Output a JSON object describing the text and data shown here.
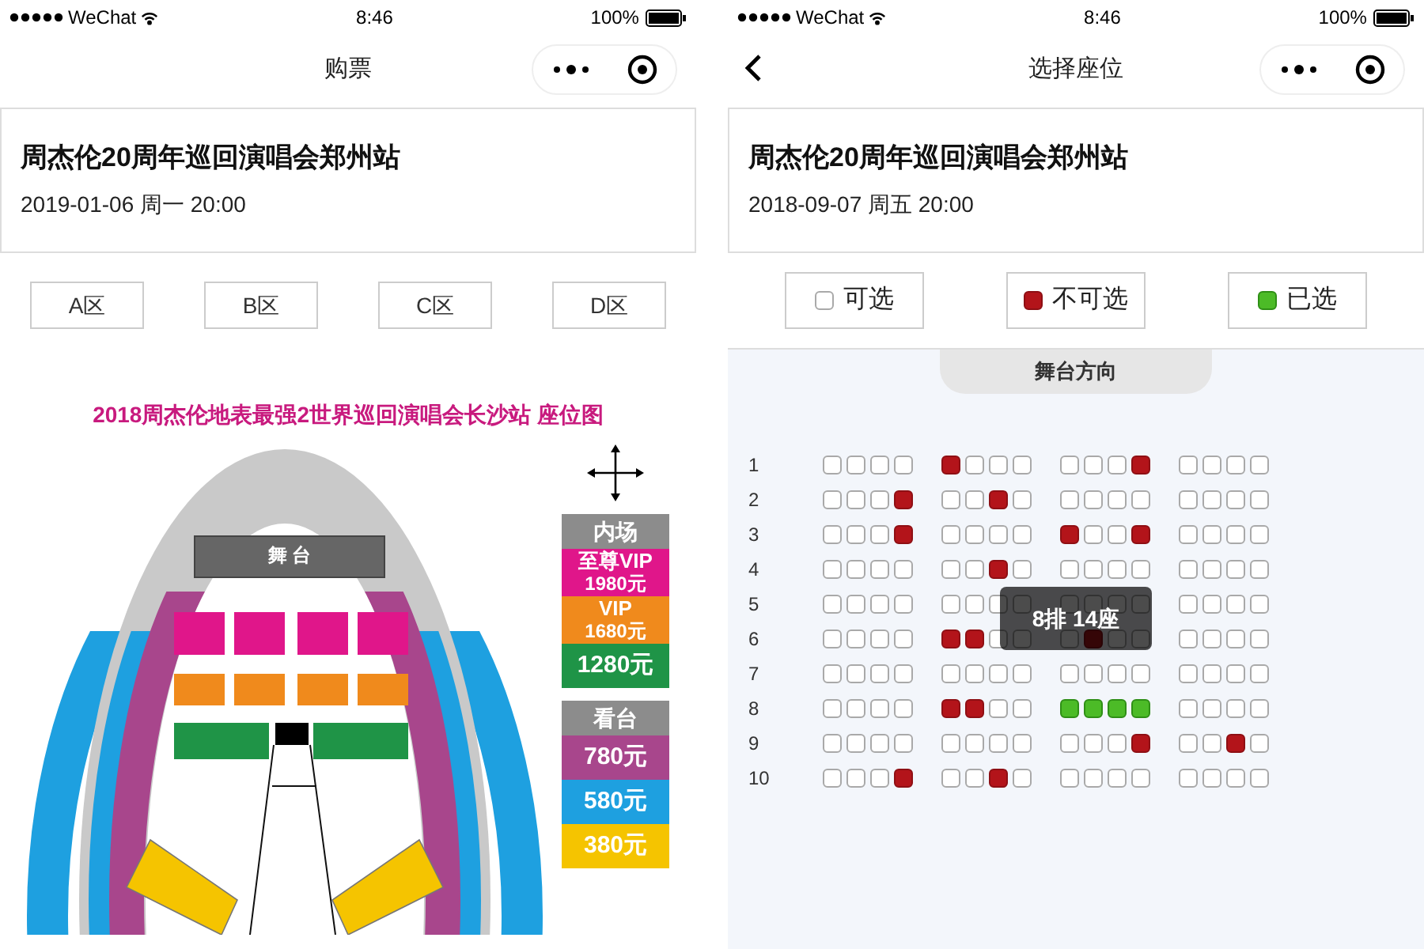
{
  "screens": [
    {
      "kind": "zone_picker",
      "status_bar": {
        "carrier": "WeChat",
        "time": "8:46",
        "battery": "100%"
      },
      "nav": {
        "title": "购票",
        "back": false
      },
      "event": {
        "title": "周杰伦20周年巡回演唱会郑州站",
        "datetime": "2019-01-06 周一 20:00"
      },
      "zones": [
        "A区",
        "B区",
        "C区",
        "D区"
      ],
      "seat_map": {
        "title": "2018周杰伦地表最强2世界巡回演唱会长沙站 座位图",
        "stage_label": "舞 台",
        "legend": [
          {
            "heading": "内场",
            "tiers": [
              {
                "name": "至尊VIP",
                "price": "1980元",
                "color": "#e0168a"
              },
              {
                "name": "VIP",
                "price": "1680元",
                "color": "#f08a1c"
              },
              {
                "price": "1280元",
                "color": "#1f9447"
              }
            ]
          },
          {
            "heading": "看台",
            "tiers": [
              {
                "price": "780元",
                "color": "#a8468c"
              },
              {
                "price": "580元",
                "color": "#1ea0e0"
              },
              {
                "price": "380元",
                "color": "#f5c400"
              }
            ]
          }
        ]
      }
    },
    {
      "kind": "seat_picker",
      "status_bar": {
        "carrier": "WeChat",
        "time": "8:46",
        "battery": "100%"
      },
      "nav": {
        "title": "选择座位",
        "back": true
      },
      "event": {
        "title": "周杰伦20周年巡回演唱会郑州站",
        "datetime": "2018-09-07 周五 20:00"
      },
      "legend": [
        {
          "label": "可选",
          "kind": "free"
        },
        {
          "label": "不可选",
          "kind": "sold"
        },
        {
          "label": "已选",
          "kind": "selected"
        }
      ],
      "stage_direction": "舞台方向",
      "rows": [
        {
          "label": "1",
          "seats": [
            {
              "kind": "free"
            },
            {
              "kind": "free"
            },
            {
              "kind": "free"
            },
            {
              "kind": "free"
            },
            {
              "kind": "sold"
            },
            {
              "kind": "free"
            },
            {
              "kind": "free"
            },
            {
              "kind": "free"
            },
            {
              "kind": "free"
            },
            {
              "kind": "free"
            },
            {
              "kind": "free"
            },
            {
              "kind": "sold"
            },
            {
              "kind": "free"
            },
            {
              "kind": "free"
            },
            {
              "kind": "free"
            },
            {
              "kind": "free"
            }
          ]
        },
        {
          "label": "2",
          "seats": [
            {
              "kind": "free"
            },
            {
              "kind": "free"
            },
            {
              "kind": "free"
            },
            {
              "kind": "sold"
            },
            {
              "kind": "free"
            },
            {
              "kind": "free"
            },
            {
              "kind": "sold"
            },
            {
              "kind": "free"
            },
            {
              "kind": "free"
            },
            {
              "kind": "free"
            },
            {
              "kind": "free"
            },
            {
              "kind": "free"
            },
            {
              "kind": "free"
            },
            {
              "kind": "free"
            },
            {
              "kind": "free"
            },
            {
              "kind": "free"
            }
          ]
        },
        {
          "label": "3",
          "seats": [
            {
              "kind": "free"
            },
            {
              "kind": "free"
            },
            {
              "kind": "free"
            },
            {
              "kind": "sold"
            },
            {
              "kind": "free"
            },
            {
              "kind": "free"
            },
            {
              "kind": "free"
            },
            {
              "kind": "free"
            },
            {
              "kind": "sold"
            },
            {
              "kind": "free"
            },
            {
              "kind": "free"
            },
            {
              "kind": "sold"
            },
            {
              "kind": "free"
            },
            {
              "kind": "free"
            },
            {
              "kind": "free"
            },
            {
              "kind": "free"
            }
          ]
        },
        {
          "label": "4",
          "seats": [
            {
              "kind": "free"
            },
            {
              "kind": "free"
            },
            {
              "kind": "free"
            },
            {
              "kind": "free"
            },
            {
              "kind": "free"
            },
            {
              "kind": "free"
            },
            {
              "kind": "sold"
            },
            {
              "kind": "free"
            },
            {
              "kind": "free"
            },
            {
              "kind": "free"
            },
            {
              "kind": "free"
            },
            {
              "kind": "free"
            },
            {
              "kind": "free"
            },
            {
              "kind": "free"
            },
            {
              "kind": "free"
            },
            {
              "kind": "free"
            }
          ]
        },
        {
          "label": "5",
          "seats": [
            {
              "kind": "free"
            },
            {
              "kind": "free"
            },
            {
              "kind": "free"
            },
            {
              "kind": "free"
            },
            {
              "kind": "free"
            },
            {
              "kind": "free"
            },
            {
              "kind": "free"
            },
            {
              "kind": "free"
            },
            {
              "kind": "free"
            },
            {
              "kind": "free"
            },
            {
              "kind": "free"
            },
            {
              "kind": "free"
            },
            {
              "kind": "free"
            },
            {
              "kind": "free"
            },
            {
              "kind": "free"
            },
            {
              "kind": "free"
            }
          ]
        },
        {
          "label": "6",
          "seats": [
            {
              "kind": "free"
            },
            {
              "kind": "free"
            },
            {
              "kind": "free"
            },
            {
              "kind": "free"
            },
            {
              "kind": "sold"
            },
            {
              "kind": "sold"
            },
            {
              "kind": "free"
            },
            {
              "kind": "free"
            },
            {
              "kind": "free"
            },
            {
              "kind": "sold"
            },
            {
              "kind": "free"
            },
            {
              "kind": "free"
            },
            {
              "kind": "free"
            },
            {
              "kind": "free"
            },
            {
              "kind": "free"
            },
            {
              "kind": "free"
            }
          ]
        },
        {
          "label": "7",
          "seats": [
            {
              "kind": "free"
            },
            {
              "kind": "free"
            },
            {
              "kind": "free"
            },
            {
              "kind": "free"
            },
            {
              "kind": "free"
            },
            {
              "kind": "free"
            },
            {
              "kind": "free"
            },
            {
              "kind": "free"
            },
            {
              "kind": "free"
            },
            {
              "kind": "free"
            },
            {
              "kind": "free"
            },
            {
              "kind": "free"
            },
            {
              "kind": "free"
            },
            {
              "kind": "free"
            },
            {
              "kind": "free"
            },
            {
              "kind": "free"
            }
          ]
        },
        {
          "label": "8",
          "seats": [
            {
              "kind": "free"
            },
            {
              "kind": "free"
            },
            {
              "kind": "free"
            },
            {
              "kind": "free"
            },
            {
              "kind": "sold"
            },
            {
              "kind": "sold"
            },
            {
              "kind": "free"
            },
            {
              "kind": "free"
            },
            {
              "kind": "selected"
            },
            {
              "kind": "selected"
            },
            {
              "kind": "selected"
            },
            {
              "kind": "selected"
            },
            {
              "kind": "free"
            },
            {
              "kind": "free"
            },
            {
              "kind": "free"
            },
            {
              "kind": "free"
            }
          ]
        },
        {
          "label": "9",
          "seats": [
            {
              "kind": "free"
            },
            {
              "kind": "free"
            },
            {
              "kind": "free"
            },
            {
              "kind": "free"
            },
            {
              "kind": "free"
            },
            {
              "kind": "free"
            },
            {
              "kind": "free"
            },
            {
              "kind": "free"
            },
            {
              "kind": "free"
            },
            {
              "kind": "free"
            },
            {
              "kind": "free"
            },
            {
              "kind": "sold"
            },
            {
              "kind": "free"
            },
            {
              "kind": "free"
            },
            {
              "kind": "sold"
            },
            {
              "kind": "free"
            }
          ]
        },
        {
          "label": "10",
          "seats": [
            {
              "kind": "free"
            },
            {
              "kind": "free"
            },
            {
              "kind": "free"
            },
            {
              "kind": "sold"
            },
            {
              "kind": "free"
            },
            {
              "kind": "free"
            },
            {
              "kind": "sold"
            },
            {
              "kind": "free"
            },
            {
              "kind": "free"
            },
            {
              "kind": "free"
            },
            {
              "kind": "free"
            },
            {
              "kind": "free"
            },
            {
              "kind": "free"
            },
            {
              "kind": "free"
            },
            {
              "kind": "free"
            },
            {
              "kind": "free"
            }
          ]
        }
      ],
      "tooltip": "8排 14座"
    }
  ]
}
